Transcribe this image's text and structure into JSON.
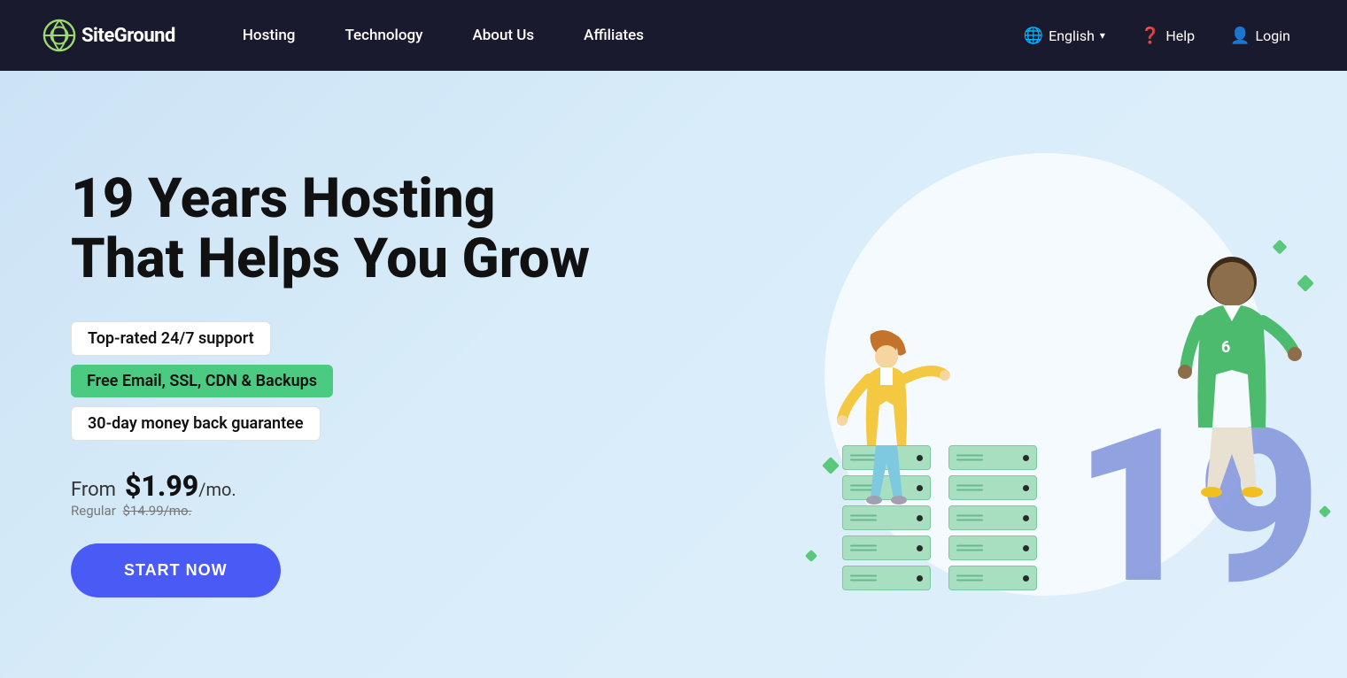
{
  "brand": {
    "name": "SiteGround",
    "logo_alt": "SiteGround logo"
  },
  "nav": {
    "links": [
      {
        "id": "hosting",
        "label": "Hosting"
      },
      {
        "id": "technology",
        "label": "Technology"
      },
      {
        "id": "about",
        "label": "About Us"
      },
      {
        "id": "affiliates",
        "label": "Affiliates"
      }
    ],
    "right": {
      "language_label": "English",
      "help_label": "Help",
      "login_label": "Login"
    }
  },
  "hero": {
    "title_line1": "19 Years Hosting",
    "title_line2": "That Helps You Grow",
    "badge1": "Top-rated 24/7 support",
    "badge2": "Free Email, SSL, CDN & Backups",
    "badge3": "30-day money back guarantee",
    "pricing_from": "From",
    "pricing_price": "$1.99",
    "pricing_per": "/mo.",
    "pricing_regular_label": "Regular",
    "pricing_regular_price": "$14.99/mo.",
    "cta_button": "START NOW",
    "number_display": "19"
  },
  "colors": {
    "nav_bg": "#1a1a2e",
    "hero_bg": "#cde4f5",
    "accent_blue": "#4a5af5",
    "accent_green": "#4bca81",
    "number_color": "#8899dd",
    "server_color": "#a8dfc0"
  }
}
